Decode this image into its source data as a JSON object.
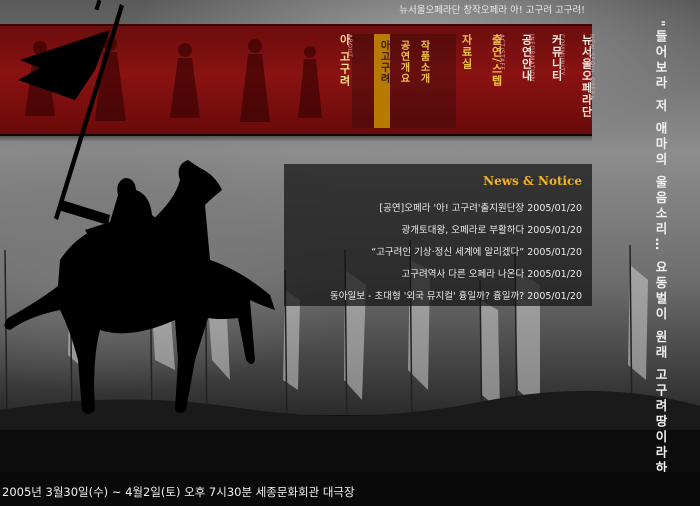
{
  "header": {
    "tagline": "뉴서울오페라단 창작오페라 아! 고구려 고구려!"
  },
  "menu": {
    "items": [
      {
        "ko": "아 고구려",
        "en": "ABOUT"
      },
      {
        "ko": "자료실",
        "en": ""
      },
      {
        "ko": "출연/스텝",
        "en": "ACT/STAFF"
      },
      {
        "ko": "공연안내",
        "en": "INFORMATION"
      },
      {
        "ko": "커뮤니티",
        "en": "COMMUNITY"
      },
      {
        "ko": "뉴서울오페라단",
        "en": "NEW SEOUL OPERA"
      }
    ],
    "submenu": [
      "아고구려",
      "공연개요",
      "작품소개"
    ]
  },
  "news": {
    "title": "News & Notice",
    "items": [
      "[공연]오페라 '아!  고구려'출지원단장 2005/01/20",
      "광개토대왕, 오페라로 부활하다 2005/01/20",
      "“고구려인 기상·정신 세계에 알리겠다” 2005/01/20",
      "고구려역사 다른 오페라 나온다 2005/01/20",
      "동아일보 - 초대형 '외국 뮤지컬' 흉일까? 흉일까? 2005/01/20"
    ]
  },
  "quote": "\"들어보라 저 애마의 울음소리… 요동벌이 원래 고구려땅이라하오\"",
  "info": {
    "text": "2005년 3월30일(수) ~ 4월2일(토) 오후 7시30분  세종문화회관 대극장"
  }
}
